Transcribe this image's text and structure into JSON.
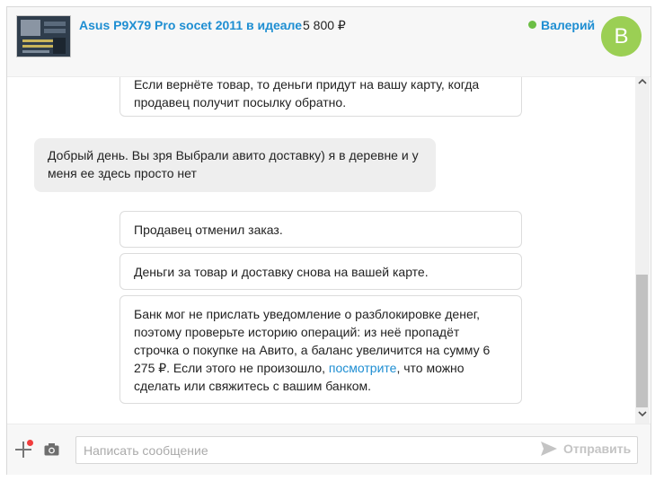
{
  "header": {
    "item_title": "Asus P9X79 Pro socet 2011 в идеале",
    "item_price": "5 800 ₽",
    "user_name": "Валерий",
    "avatar_letter": "В",
    "online_color": "#6cbe45",
    "avatar_color": "#9bcf54",
    "link_color": "#1e8ed2"
  },
  "messages": {
    "m1": "Если вернёте товар, то деньги придут на вашу карту, когда продавец получит посылку обратно.",
    "m2": "Добрый день. Вы зря Выбрали авито доставку) я в деревне и у меня ее здесь просто нет",
    "m3": "Продавец отменил заказ.",
    "m4": "Деньги за товар и доставку снова на вашей карте.",
    "m5_before": "Банк мог не прислать уведомление о разблокировке денег, поэтому проверьте историю операций: из неё пропадёт строчка о покупке на Авито, а баланс увеличится на сумму 6 275 ₽. Если этого не произошло, ",
    "m5_link": "посмотрите",
    "m5_after": ", что можно сделать или свяжитесь с вашим банком."
  },
  "composer": {
    "placeholder": "Написать сообщение",
    "send_label": "Отправить",
    "icons": [
      "plus-icon",
      "notification-dot",
      "camera-icon",
      "send-icon"
    ]
  }
}
